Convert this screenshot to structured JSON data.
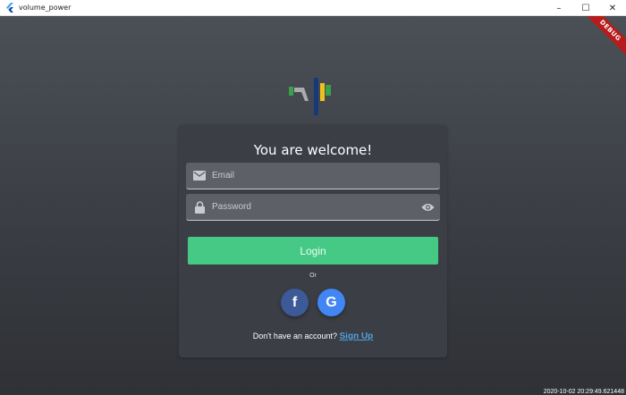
{
  "window": {
    "title": "volume_power",
    "minimize": "–",
    "maximize": "☐",
    "close": "✕"
  },
  "debug_banner": "DEBUG",
  "login": {
    "heading": "You are welcome!",
    "email_placeholder": "Email",
    "password_placeholder": "Password",
    "login_button": "Login",
    "or_text": "Or",
    "no_account_text": "Don't have an account?",
    "signup_link": "Sign Up"
  },
  "social": {
    "facebook_glyph": "f",
    "google_glyph": "G"
  },
  "timestamp": "2020-10-02 20:29:49.621448",
  "colors": {
    "login_green": "#45c985",
    "facebook_blue": "#3d5a98",
    "google_blue": "#4285f4",
    "link_blue": "#4fa3e0"
  }
}
